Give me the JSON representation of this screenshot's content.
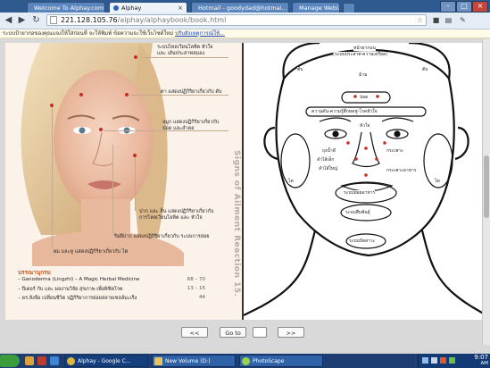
{
  "browser": {
    "tabs": [
      {
        "title": "Welcome To Alphay.com",
        "active": false
      },
      {
        "title": "Alphay",
        "active": true
      },
      {
        "title": "Hotmail - goodydad@hotmai...",
        "active": false
      },
      {
        "title": "Manage Webiz!",
        "active": false
      }
    ],
    "url_host": "221.128.105.76",
    "url_path": "/alphay/alphaybook/book.html",
    "info_bar": {
      "text": "ระบบป้ายาก่อของคุณแจงให้ใส่ก่อนที่ จะให้พิมพ์ ข้อความจะใช้เว็บไซต์ใหม่",
      "link": "ปรับสังเหตุการณ์ให้..."
    },
    "window_buttons": [
      "–",
      "□",
      "×"
    ]
  },
  "book": {
    "left_page": {
      "annotations": [
        "ระบบไหลเวียนโลหิต หัวใจ",
        "และ เส้นประสาทสมอง",
        "ตา แสดงปฏิกิริยาเกี่ยวกับ ตับ",
        "จมูก แสดงปฏิกิริยาเกี่ยวกับ",
        "ปอด และลำคอ",
        "ปาก และ ลิ้น แสดงปฏิกิริยาเกี่ยวกับ",
        "การไหลเวียนโลหิต และ หัวใจ",
        "ริมฝีปาก แสดงปฏิกิริยาเกี่ยวกับ ระบบการย่อย",
        "ผม และหู แสดงปฏิกิริยาเกี่ยวกับ ไต"
      ],
      "vertical_title": "Signs of Ailment Reaction 15.",
      "contents_title": "บรรณานุกรม",
      "contents": [
        {
          "label": "– Ganoderma (Lingzhi) – A Magic Herbal Medicine",
          "pages": "68 – 70"
        },
        {
          "label": "– ปีเตอร์ กับ และ ผลงานวิจัย สุขภาพ เพื่อพิชิตโรค",
          "pages": "13 – 15"
        },
        {
          "label": "– ดร.ลิงจือ เปลี่ยนชีวิต ปฏิกิริยาการย่อยสลายเซลล์มะเร็ง",
          "pages": "44"
        }
      ]
    },
    "right_page": {
      "face_labels": [
        "หน้าผากบน",
        "(ระบบประสาท-ความเครียด)",
        "ตับ",
        "ม้าม",
        "ตับ",
        "ปอด",
        "ความดัน-ความรู้สึกหดหู่-โรคหัวใจ",
        "หัวใจ",
        "ถุงน้ำดี",
        "กระเพาะ",
        "ลำไส้เล็ก",
        "ลำไส้ใหญ่",
        "กระเพาะอาหาร",
        "ระบบย่อยอาหาร",
        "ระบบสืบพันธุ์",
        "ระบบปัสสาวะ",
        "ไต",
        "ไต"
      ]
    },
    "pager": {
      "prev": "<<",
      "goto": "Go to",
      "page_input": "",
      "next": ">>"
    }
  },
  "taskbar": {
    "items": [
      {
        "label": "Alphay - Google C..."
      },
      {
        "label": "New Volume (D:)"
      },
      {
        "label": "PhotoScape"
      }
    ],
    "clock_time": "9:07",
    "clock_ampm": "AM"
  },
  "colors": {
    "tabbar": "#2f5a8f",
    "accent": "#c25a26"
  }
}
